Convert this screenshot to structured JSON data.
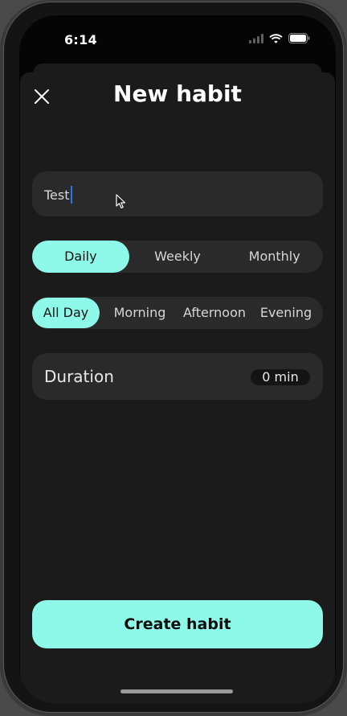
{
  "status_bar": {
    "time": "6:14",
    "icons": [
      "signal-icon",
      "wifi-icon",
      "battery-icon"
    ]
  },
  "header": {
    "title": "New habit",
    "close_icon": "close-icon"
  },
  "habit_name_field": {
    "value": "Test"
  },
  "frequency": {
    "options": [
      "Daily",
      "Weekly",
      "Monthly"
    ],
    "selected": "Daily"
  },
  "time_of_day": {
    "options": [
      "All Day",
      "Morning",
      "Afternoon",
      "Evening"
    ],
    "selected": "All Day"
  },
  "duration": {
    "label": "Duration",
    "value": "0 min"
  },
  "create_button": {
    "label": "Create habit"
  },
  "colors": {
    "accent": "#8ef9e8",
    "background": "#1b1b1b",
    "surface": "#2a2a2a",
    "caret": "#2c72f0"
  }
}
